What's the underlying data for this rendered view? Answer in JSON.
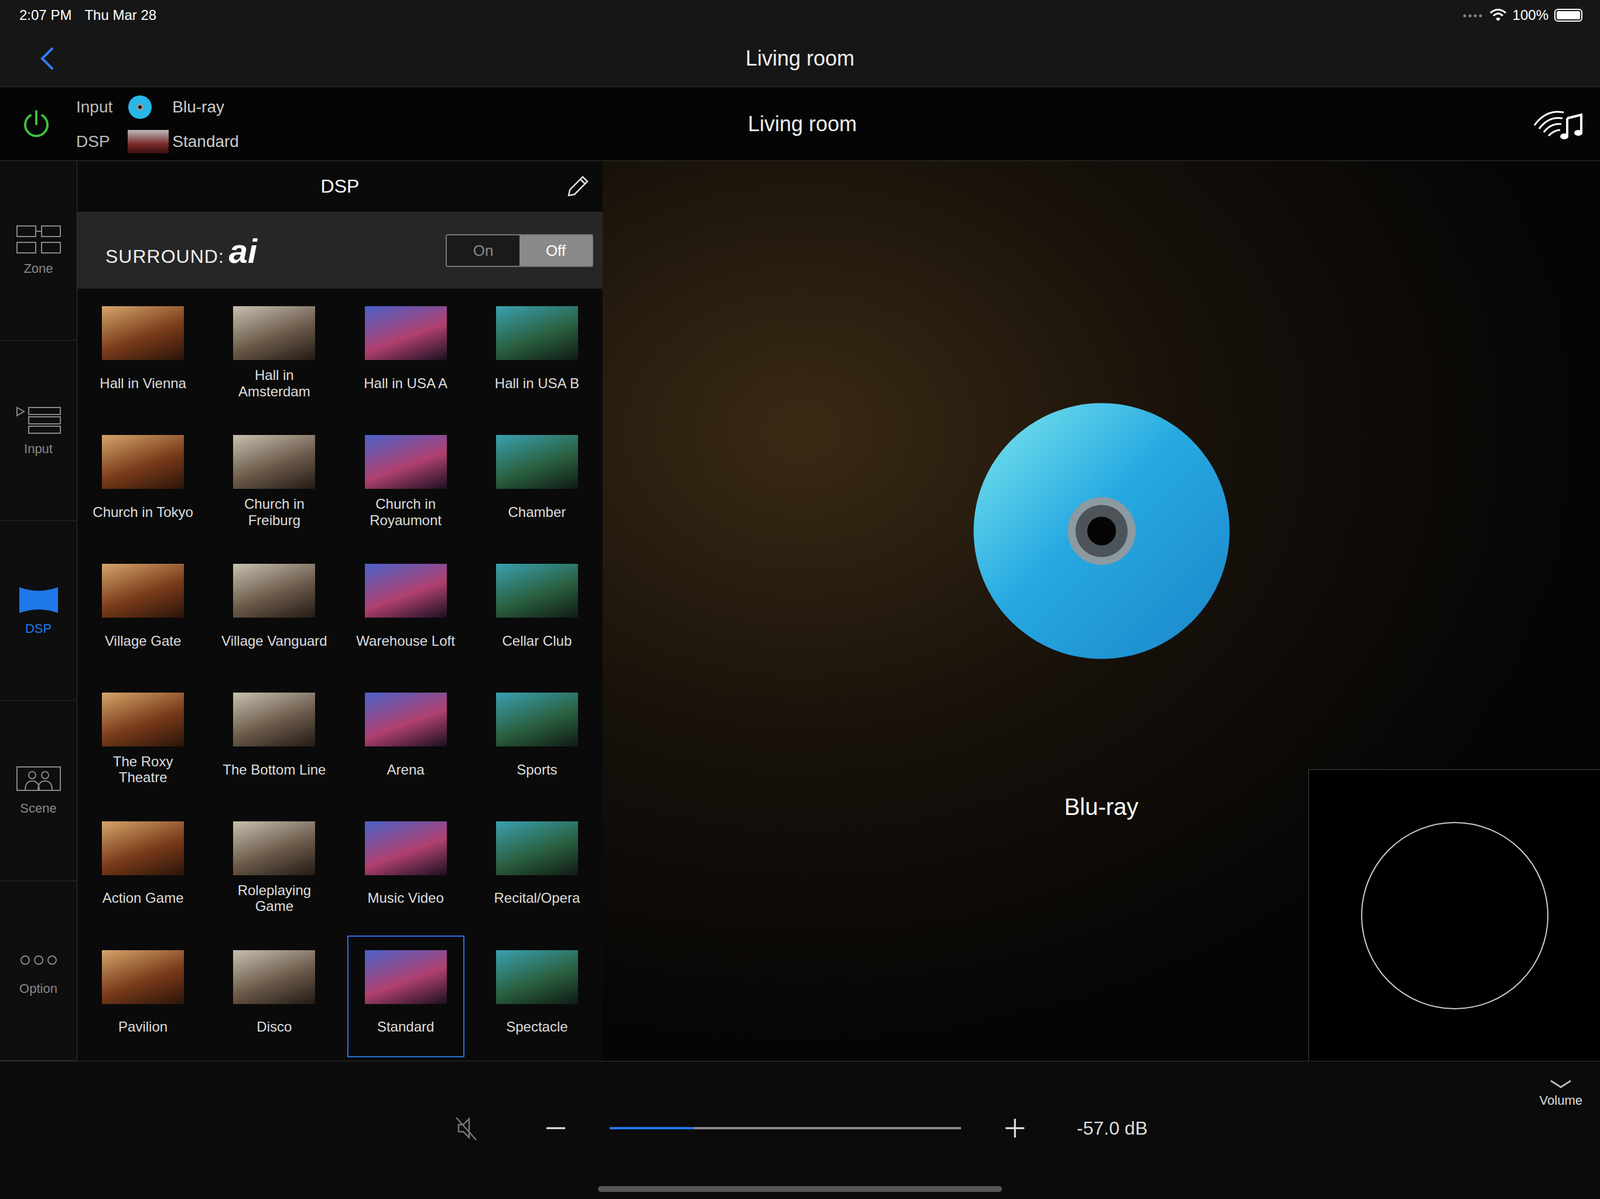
{
  "status_bar": {
    "time": "2:07 PM",
    "date": "Thu Mar 28",
    "battery": "100%",
    "battery_level": 1
  },
  "nav": {
    "title": "Living room"
  },
  "info": {
    "power": true,
    "input": {
      "label": "Input",
      "value": "Blu-ray"
    },
    "dsp": {
      "label": "DSP",
      "value": "Standard"
    },
    "room": "Living room"
  },
  "sidebar": {
    "items": [
      {
        "label": "Zone",
        "kind": "zone",
        "selected": false
      },
      {
        "label": "Input",
        "kind": "input",
        "selected": false
      },
      {
        "label": "DSP",
        "kind": "dsp",
        "selected": true
      },
      {
        "label": "Scene",
        "kind": "scene",
        "selected": false
      },
      {
        "label": "Option",
        "kind": "option",
        "selected": false
      }
    ]
  },
  "dsp_panel": {
    "title": "DSP",
    "surround": {
      "brand": "SURROUND:",
      "logo": "ai",
      "options": [
        {
          "label": "On",
          "selected": false
        },
        {
          "label": "Off",
          "selected": true
        }
      ]
    },
    "programs": [
      {
        "name": "Hall in Vienna",
        "selected": false
      },
      {
        "name": "Hall in Amsterdam",
        "selected": false
      },
      {
        "name": "Hall in USA A",
        "selected": false
      },
      {
        "name": "Hall in USA B",
        "selected": false
      },
      {
        "name": "Church in Tokyo",
        "selected": false
      },
      {
        "name": "Church in Freiburg",
        "selected": false
      },
      {
        "name": "Church in Royaumont",
        "selected": false
      },
      {
        "name": "Chamber",
        "selected": false
      },
      {
        "name": "Village Gate",
        "selected": false
      },
      {
        "name": "Village Vanguard",
        "selected": false
      },
      {
        "name": "Warehouse Loft",
        "selected": false
      },
      {
        "name": "Cellar Club",
        "selected": false
      },
      {
        "name": "The Roxy Theatre",
        "selected": false
      },
      {
        "name": "The Bottom Line",
        "selected": false
      },
      {
        "name": "Arena",
        "selected": false
      },
      {
        "name": "Sports",
        "selected": false
      },
      {
        "name": "Action Game",
        "selected": false
      },
      {
        "name": "Roleplaying Game",
        "selected": false
      },
      {
        "name": "Music Video",
        "selected": false
      },
      {
        "name": "Recital/Opera",
        "selected": false
      },
      {
        "name": "Pavilion",
        "selected": false
      },
      {
        "name": "Disco",
        "selected": false
      },
      {
        "name": "Standard",
        "selected": true
      },
      {
        "name": "Spectacle",
        "selected": false
      }
    ]
  },
  "player": {
    "source": "Blu-ray"
  },
  "volume": {
    "label": "Volume",
    "muted": false,
    "level": 0.24,
    "reading": "-57.0 dB"
  }
}
